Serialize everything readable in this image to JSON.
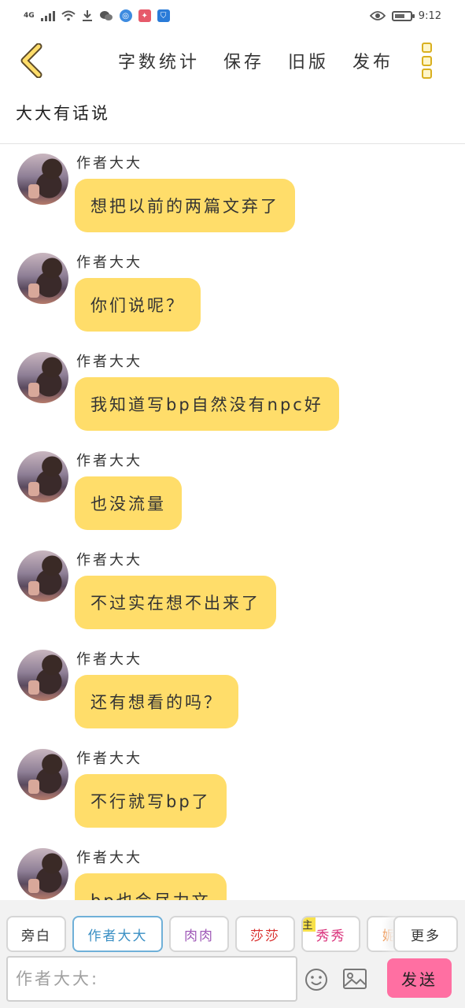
{
  "status_bar": {
    "network": "4G",
    "time": "9:12",
    "icons": [
      "signal-icon",
      "wifi-icon",
      "download-icon",
      "wechat-icon",
      "browser-icon",
      "app-icon",
      "shield-icon",
      "eye-icon",
      "battery-icon"
    ]
  },
  "nav": {
    "back_icon": "chevron-left-icon",
    "actions": [
      "字数统计",
      "保存",
      "旧版",
      "发布"
    ],
    "more_icon": "more-vertical-icon",
    "accent_color": "#ffdd6a"
  },
  "section_title": "大大有话说",
  "messages": [
    {
      "sender": "作者大大",
      "text": "想把以前的两篇文弃了"
    },
    {
      "sender": "作者大大",
      "text": "你们说呢？"
    },
    {
      "sender": "作者大大",
      "text": "我知道写bp自然没有npc好"
    },
    {
      "sender": "作者大大",
      "text": "也没流量"
    },
    {
      "sender": "作者大大",
      "text": "不过实在想不出来了"
    },
    {
      "sender": "作者大大",
      "text": "还有想看的吗？"
    },
    {
      "sender": "作者大大",
      "text": "不行就写bp了"
    },
    {
      "sender": "作者大大",
      "text": "bp也会尽力文"
    }
  ],
  "roles": {
    "chips": [
      {
        "label": "旁白",
        "color": "#333333",
        "active": false,
        "main": false
      },
      {
        "label": "作者大大",
        "color": "#3a8fc4",
        "active": true,
        "main": false
      },
      {
        "label": "肉肉",
        "color": "#a05ab8",
        "active": false,
        "main": false
      },
      {
        "label": "莎莎",
        "color": "#d9302f",
        "active": false,
        "main": false
      },
      {
        "label": "秀秀",
        "color": "#d9307a",
        "active": false,
        "main": true
      },
      {
        "label": "妮",
        "color": "#f08a3c",
        "active": false,
        "main": false
      }
    ],
    "main_tag": "主",
    "more_label": "更多"
  },
  "composer": {
    "placeholder": "作者大大:",
    "value": "",
    "emoji_icon": "smiley-icon",
    "image_icon": "image-icon",
    "send_label": "发送",
    "send_color": "#ff6fa2"
  }
}
